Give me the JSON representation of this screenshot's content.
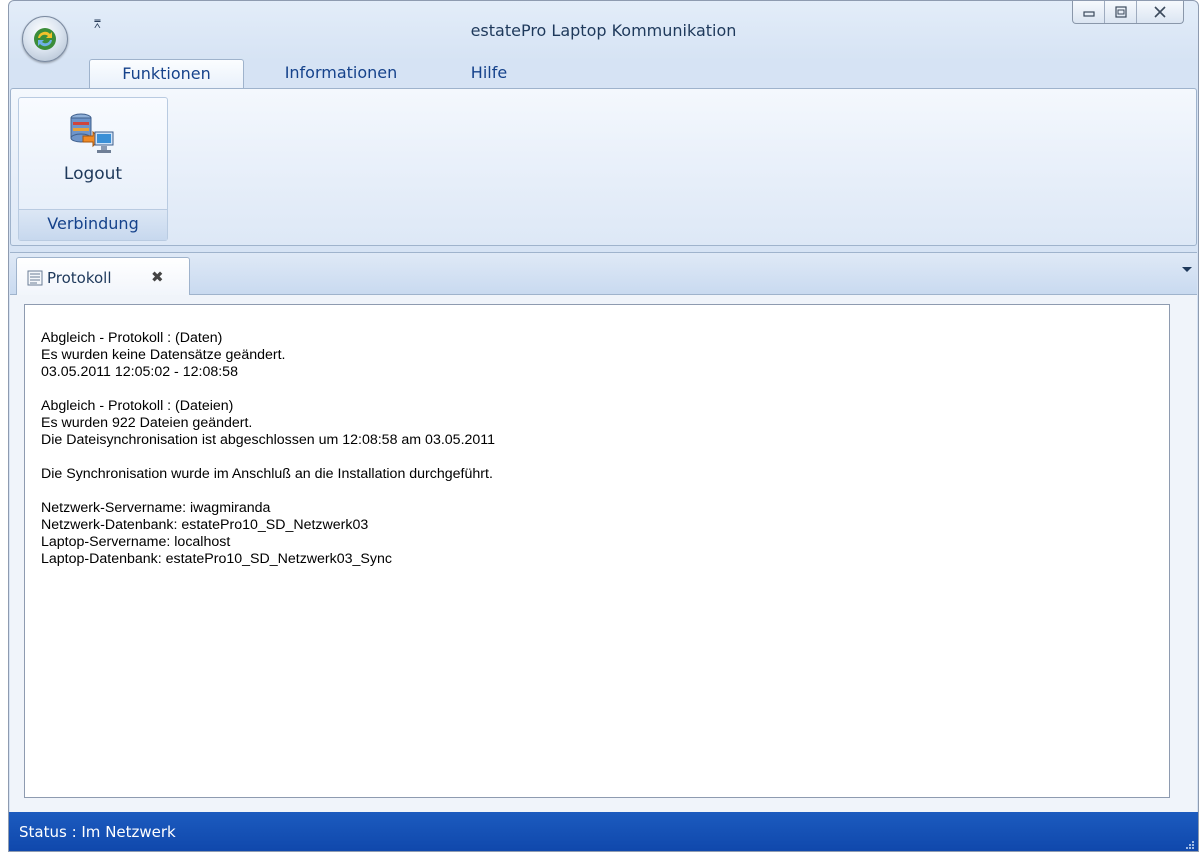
{
  "window": {
    "title": "estatePro Laptop Kommunikation",
    "qat_arrow": "⩞"
  },
  "ribbon": {
    "tabs": [
      {
        "label": "Funktionen",
        "active": true
      },
      {
        "label": "Informationen",
        "active": false
      },
      {
        "label": "Hilfe",
        "active": false
      }
    ],
    "groups": [
      {
        "label": "Verbindung",
        "buttons": [
          {
            "label": "Logout",
            "icon": "database-sync-icon"
          }
        ]
      }
    ]
  },
  "document_tabs": [
    {
      "label": "Protokoll",
      "close": "✖",
      "icon": "document-icon"
    }
  ],
  "log": {
    "lines": [
      "Abgleich - Protokoll : (Daten)",
      "Es wurden keine Datensätze geändert.",
      "03.05.2011 12:05:02 - 12:08:58",
      "",
      "Abgleich - Protokoll : (Dateien)",
      "Es wurden 922 Dateien geändert.",
      "Die Dateisynchronisation ist abgeschlossen um 12:08:58 am 03.05.2011",
      "",
      "Die Synchronisation wurde im Anschluß an die Installation durchgeführt.",
      "",
      "Netzwerk-Servername: iwagmiranda",
      "Netzwerk-Datenbank: estatePro10_SD_Netzwerk03",
      "Laptop-Servername: localhost",
      "Laptop-Datenbank: estatePro10_SD_Netzwerk03_Sync"
    ]
  },
  "statusbar": {
    "text": "Status : Im Netzwerk"
  },
  "colors": {
    "statusbar": "#1450b5",
    "ribbon_text": "#15428b"
  }
}
